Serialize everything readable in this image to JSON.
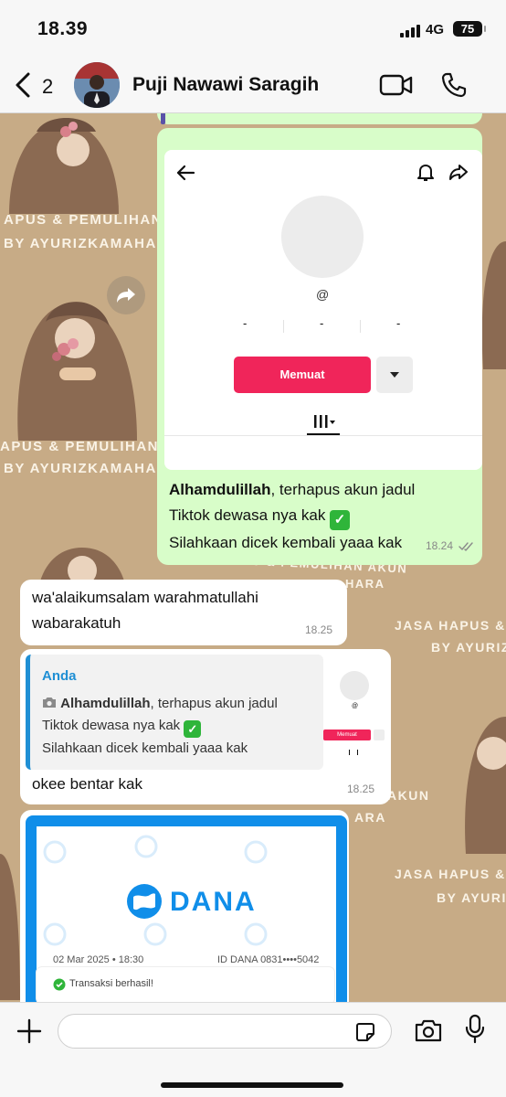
{
  "status_bar": {
    "time": "18.39",
    "network": "4G",
    "battery": "75"
  },
  "header": {
    "back_count": "2",
    "contact_name": "Puji Nawawi Saragih"
  },
  "wallpaper": {
    "lines": [
      "APUS & PEMULIHAN",
      "BY AYURIZKAMAHARA",
      "JASA HAPUS & PEMULIHAN AKUN",
      "HARA",
      "JASA HAPUS & P",
      "BY AYURIZ",
      "AKUN",
      "ARA"
    ]
  },
  "messages": {
    "m1": {
      "screenshot": {
        "at_sign": "@",
        "stats": [
          "-",
          "-",
          "-"
        ],
        "load_button": "Memuat"
      },
      "bold": "Alhamdulillah",
      "line1_rest": ", terhapus akun jadul",
      "line2": "Tiktok dewasa nya kak",
      "line3": "Silahkaan dicek kembali yaaa kak",
      "check": "✓",
      "time": "18.24"
    },
    "m2": {
      "line1": "wa'alaikumsalam warahmatullahi",
      "line2": "wabarakatuh",
      "time": "18.25"
    },
    "m3": {
      "quote_author": "Anda",
      "quote_bold": "Alhamdulillah",
      "quote_line1_rest": ", terhapus akun jadul",
      "quote_line2": "Tiktok dewasa nya kak",
      "quote_line3": "Silahkaan dicek kembali yaaa kak",
      "thumb_button": "Memuat",
      "thumb_at": "@",
      "reply": "okee bentar kak",
      "time": "18.25"
    },
    "m4": {
      "brand": "DANA",
      "date": "02 Mar 2025 • 18:30",
      "account": "ID DANA 0831••••5042",
      "status": "Transaksi berhasil!"
    }
  },
  "colors": {
    "outgoing": "#d8fdc9",
    "incoming": "#ffffff",
    "tiktok_red": "#f0255a",
    "dana_blue": "#108ee9",
    "reply_blue": "#1f8fd4"
  }
}
